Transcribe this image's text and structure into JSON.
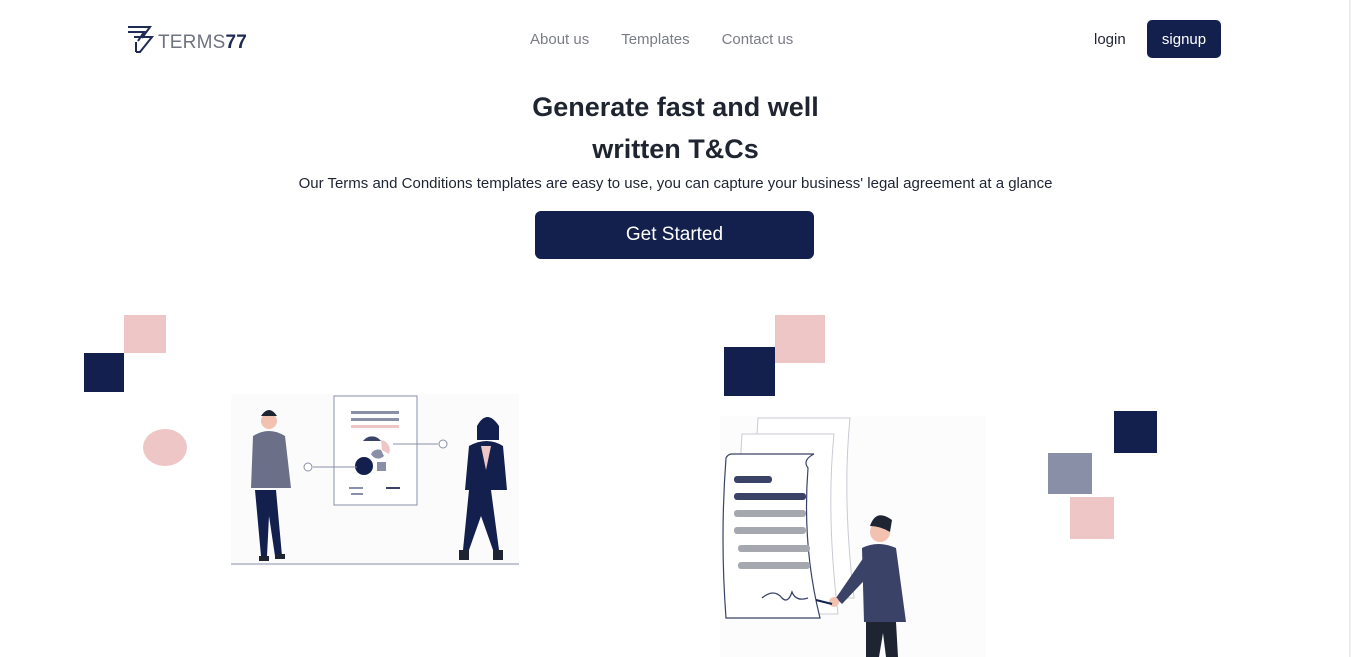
{
  "brand": {
    "name_prefix": "TERMS",
    "name_suffix": "77",
    "logo_icon": "terms-logo-icon"
  },
  "nav": {
    "links": [
      {
        "label": "About us"
      },
      {
        "label": "Templates"
      },
      {
        "label": "Contact us"
      }
    ],
    "login_label": "login",
    "signup_label": "signup"
  },
  "hero": {
    "title_line1": "Generate fast and well",
    "title_line2": "written T&Cs",
    "subtitle": "Our Terms and Conditions templates are easy to use, you can capture your business' legal agreement at a glance",
    "cta_label": "Get Started"
  },
  "colors": {
    "navy": "#13204d",
    "pink": "#efc6c6",
    "gray": "#8a8fa8",
    "text": "#1f2433",
    "muted": "#7a7d85"
  },
  "illustrations": [
    {
      "icon": "presentation-illustration"
    },
    {
      "icon": "signing-document-illustration"
    }
  ]
}
